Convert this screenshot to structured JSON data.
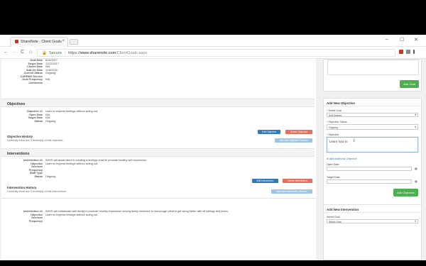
{
  "browser": {
    "tab_title": "ShareNote - Client Goals",
    "tab_close": "×",
    "win_min": "–",
    "win_max": "☐",
    "win_close": "✕",
    "nav_back": "←",
    "nav_forward": "→",
    "nav_reload": "C",
    "nav_home": "⌂",
    "url_secure": "Secure",
    "url_sep": "|",
    "url_scheme": "https://",
    "url_host": "www.sharenote.com",
    "url_path": "/ClientGoals.aspx"
  },
  "goal_details": [
    {
      "k": "Goal Date",
      "v": "8/16/2017"
    },
    {
      "k": "Target Date",
      "v": "12/22/2017"
    },
    {
      "k": "Closed Date",
      "v": "N/A"
    },
    {
      "k": "Add-On Date",
      "v": "11/6/2016"
    },
    {
      "k": "Current Status",
      "v": "Ongoing"
    },
    {
      "k": "CARF800 Service",
      "v": ""
    },
    {
      "k": "Goal Frequency",
      "v": "N/A"
    },
    {
      "k": "Comments",
      "v": ""
    }
  ],
  "objectives": {
    "header": "Objectives",
    "fields": [
      {
        "k": "Objective #1",
        "v": "Learn to express feelings without acting out."
      },
      {
        "k": "Open Date",
        "v": "N/A"
      },
      {
        "k": "Target Date",
        "v": "N/A"
      },
      {
        "k": "Status",
        "v": "Ongoing"
      }
    ],
    "edit_label": "Edit Objective",
    "delete_label": "Delete Objective",
    "history_title": "Objective History",
    "history_text": "Currently there are 0 review(s) of this objective.",
    "add_review_label": "Add New Objective Review"
  },
  "interventions": {
    "header": "Interventions",
    "fields": [
      {
        "k": "Intervention #1",
        "v": "SHHS will assist client in creating a feelings chart to promote healthy self-expression."
      },
      {
        "k": "Objective",
        "v": "Learn to express feelings without acting out."
      },
      {
        "k": "Services",
        "v": ""
      },
      {
        "k": "Frequency",
        "v": ""
      },
      {
        "k": "Staff Type",
        "v": ""
      },
      {
        "k": "Status",
        "v": "Ongoing"
      }
    ],
    "edit_label": "Edit Intervention",
    "delete_label": "Delete Intervention",
    "history_title": "Intervention History",
    "history_text": "Currently there are 0 review(s) of this intervention.",
    "add_review_label": "Add New Intervention Review",
    "second": [
      {
        "k": "Intervention #2",
        "v": "SHHS will collaborate with family to promote healthy expression among family members to encourage client to get along better with all siblings and peers."
      },
      {
        "k": "Objective",
        "v": "Learn to express feelings without acting out."
      },
      {
        "k": "Services",
        "v": ""
      },
      {
        "k": "Frequency",
        "v": ""
      }
    ]
  },
  "sidebar": {
    "add_goal_label": "Add Goal",
    "add_objective": {
      "header": "Add New Objective",
      "select_goal_label": "Select Goal",
      "select_goal_value": "Self Esteem",
      "status_label": "Objective Status",
      "status_value": "Ongoing",
      "objective_label": "Objective",
      "objective_value": "Learn how to",
      "add_more_link": "Add Additional Objective",
      "open_date_label": "Open Date",
      "target_date_label": "Target Date",
      "submit_label": "Add Objective"
    },
    "add_intervention": {
      "header": "Add New Intervention",
      "select_goal_label": "Select Goal",
      "select_goal_value": "Select Goal"
    }
  },
  "icons": {
    "calendar": "▦",
    "caret": "▾",
    "text_cursor": "I",
    "required": "*",
    "plus": "⊕"
  }
}
